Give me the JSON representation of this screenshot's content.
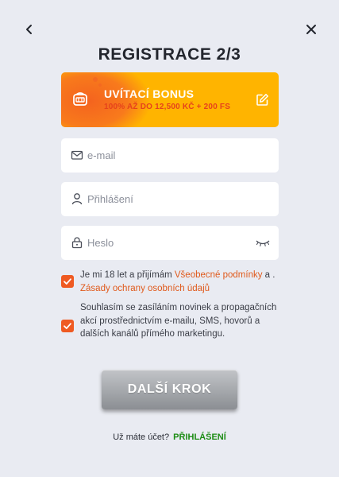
{
  "header": {
    "back_icon": "chevron-left-icon",
    "close_icon": "close-icon",
    "title": "REGISTRACE 2/3"
  },
  "bonus": {
    "title": "UVÍTACÍ BONUS",
    "subtitle": "100% AŽ DO 12,500 KČ + 200 FS",
    "icon": "slot-machine-icon",
    "edit_icon": "edit-icon",
    "bg_color": "#ffb400",
    "accent_color": "#e6421c"
  },
  "form": {
    "email": {
      "placeholder": "e-mail",
      "value": "",
      "icon": "mail-icon"
    },
    "login": {
      "placeholder": "Přihlášení",
      "value": "",
      "icon": "user-icon"
    },
    "password": {
      "placeholder": "Heslo",
      "value": "",
      "icon": "lock-icon",
      "toggle_icon": "eye-closed-icon"
    }
  },
  "consents": {
    "age": {
      "checked": true,
      "text_before": "Je mi 18 let a přijímám ",
      "link1": "Všeobecné podmínky",
      "text_mid": " a . ",
      "link2": "Zásady ochrany osobních údajů"
    },
    "marketing": {
      "checked": true,
      "text": "Souhlasím se zasíláním novinek a propagačních akcí prostřednictvím e-mailu, SMS, hovorů a dalších kanálů přímého marketingu."
    },
    "checkbox_color": "#ef5a22"
  },
  "actions": {
    "next_label": "DALŠÍ KROK",
    "have_account": "Už máte účet?",
    "login_label": "PŘIHLÁŠENÍ",
    "login_color": "#1c8c14"
  }
}
